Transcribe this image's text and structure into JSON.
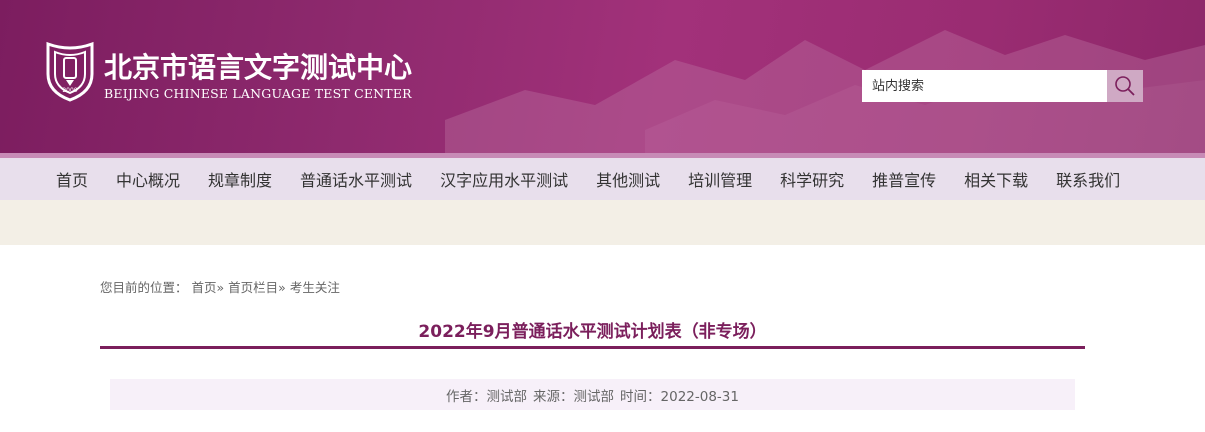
{
  "header": {
    "org_name_cn": "北京市语言文字测试中心",
    "org_name_en": "BEIJING CHINESE LANGUAGE TEST CENTER",
    "logo_icon": "shield-emblem-icon",
    "search": {
      "placeholder": "站内搜索",
      "button_icon": "search-icon"
    }
  },
  "nav": {
    "items": [
      {
        "label": "首页"
      },
      {
        "label": "中心概况"
      },
      {
        "label": "规章制度"
      },
      {
        "label": "普通话水平测试"
      },
      {
        "label": "汉字应用水平测试"
      },
      {
        "label": "其他测试"
      },
      {
        "label": "培训管理"
      },
      {
        "label": "科学研究"
      },
      {
        "label": "推普宣传"
      },
      {
        "label": "相关下载"
      },
      {
        "label": "联系我们"
      }
    ]
  },
  "breadcrumb": {
    "prefix": "您目前的位置：",
    "items": [
      "首页",
      "首页栏目",
      "考生关注"
    ],
    "separator": "»"
  },
  "article": {
    "title": "2022年9月普通话水平测试计划表（非专场）",
    "author": "作者：测试部",
    "source": "来源：测试部",
    "time": "时间：2022-08-31"
  },
  "colors": {
    "brand": "#7b1f5c",
    "banner": "#9a2c72",
    "nav_bg": "#e8dfec",
    "meta_bg": "#f7f0f9"
  }
}
